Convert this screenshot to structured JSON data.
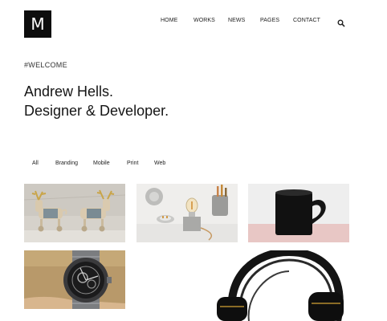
{
  "logo": {
    "letter": "M"
  },
  "nav": {
    "items": [
      {
        "label": "HOME"
      },
      {
        "label": "WORKS"
      },
      {
        "label": "NEWS"
      },
      {
        "label": "PAGES"
      },
      {
        "label": "CONTACT"
      }
    ],
    "search_icon": "search-icon"
  },
  "hero": {
    "tag": "#WELCOME",
    "line1": "Andrew Hells.",
    "line2": "Designer & Developer."
  },
  "filters": {
    "items": [
      {
        "label": "All"
      },
      {
        "label": "Branding"
      },
      {
        "label": "Mobile"
      },
      {
        "label": "Print"
      },
      {
        "label": "Web"
      }
    ]
  },
  "portfolio": {
    "tiles": [
      {
        "subject": "wooden-reindeer-toys"
      },
      {
        "subject": "concrete-lamp-and-pencil-holder"
      },
      {
        "subject": "black-heart-handle-mug"
      },
      {
        "subject": "skeleton-wristwatch"
      },
      {
        "subject": "black-headphones"
      }
    ]
  },
  "colors": {
    "logo_bg": "#0d0d0d",
    "text": "#222222",
    "mug_pink": "#e8c7c5"
  }
}
